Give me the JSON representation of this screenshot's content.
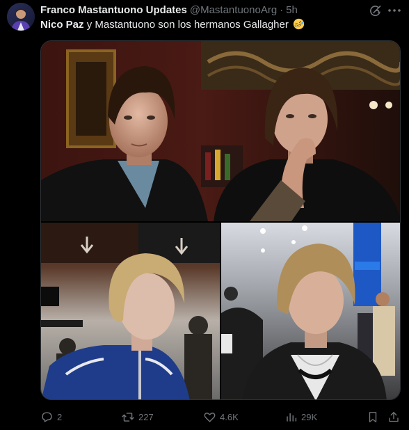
{
  "tweet": {
    "display_name": "Franco Mastantuono Updates",
    "handle": "@MastantuonoArg",
    "separator": "·",
    "time": "5h",
    "text_bold": "Nico Paz",
    "text_rest": " y Mastantuono son los hermanos Gallagher",
    "emoji": "rolling-on-the-floor-laughing"
  },
  "media": {
    "photos": [
      {
        "subject": "two-men-leather-jackets"
      },
      {
        "subject": "young-man-blue-track-jacket-airport"
      },
      {
        "subject": "young-man-black-jacket-airport"
      }
    ]
  },
  "actions": {
    "replies": "2",
    "reposts": "227",
    "likes": "4.6K",
    "views": "29K"
  },
  "colors": {
    "background": "#000000",
    "text": "#e7e9ea",
    "secondary": "#71767b",
    "border": "#2f3336"
  }
}
